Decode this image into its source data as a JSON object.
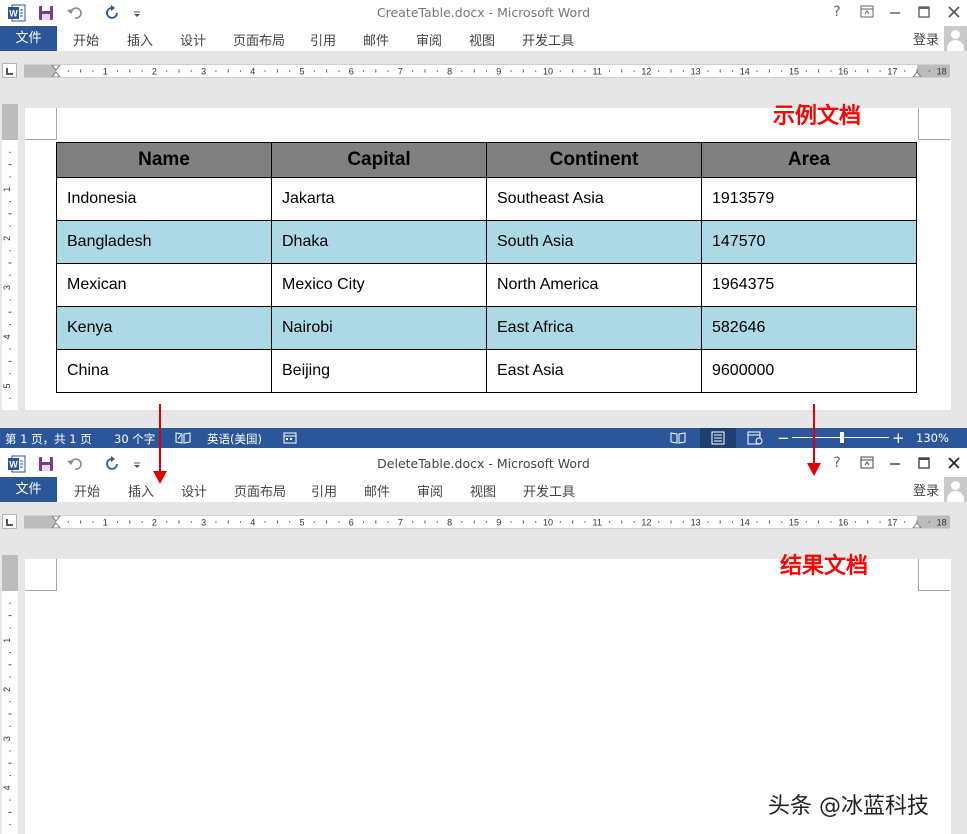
{
  "ribbon_tabs": [
    "文件",
    "开始",
    "插入",
    "设计",
    "页面布局",
    "引用",
    "邮件",
    "审阅",
    "视图",
    "开发工具"
  ],
  "login": "登录",
  "help": "?",
  "ruler_labels": [
    "1",
    "2",
    "3",
    "4",
    "5",
    "6",
    "7",
    "8",
    "9",
    "10",
    "11",
    "12",
    "13",
    "14",
    "15",
    "16",
    "17",
    "18"
  ],
  "vruler_labels": [
    "1",
    "2",
    "3",
    "4",
    "5"
  ],
  "window1": {
    "title": "CreateTable.docx - Microsoft Word",
    "annotation": "示例文档",
    "table": {
      "headers": [
        "Name",
        "Capital",
        "Continent",
        "Area"
      ],
      "rows": [
        [
          "Indonesia",
          "Jakarta",
          "Southeast Asia",
          "1913579"
        ],
        [
          "Bangladesh",
          "Dhaka",
          "South Asia",
          "147570"
        ],
        [
          "Mexican",
          "Mexico City",
          "North America",
          "1964375"
        ],
        [
          "Kenya",
          "Nairobi",
          "East Africa",
          "582646"
        ],
        [
          "China",
          "Beijing",
          "East Asia",
          "9600000"
        ]
      ],
      "header_bg": "#808080",
      "alt_row_bg": "#add8e6"
    },
    "status": {
      "page": "第 1 页，共 1 页",
      "words": "30 个字",
      "language": "英语(美国)",
      "zoom": "130%"
    }
  },
  "window2": {
    "title": "DeleteTable.docx - Microsoft Word",
    "annotation": "结果文档"
  },
  "watermark": "头条 @冰蓝科技",
  "colors": {
    "accent": "#2b579a",
    "annotation": "#ff0000"
  },
  "icons": [
    "word-app-icon",
    "save-icon",
    "undo-icon",
    "redo-icon",
    "customize-qat-icon",
    "help-icon",
    "ribbon-display-icon",
    "minimize-icon",
    "maximize-icon",
    "close-icon",
    "user-avatar-icon",
    "proofing-icon",
    "macro-icon",
    "read-mode-icon",
    "print-layout-icon",
    "web-layout-icon"
  ]
}
